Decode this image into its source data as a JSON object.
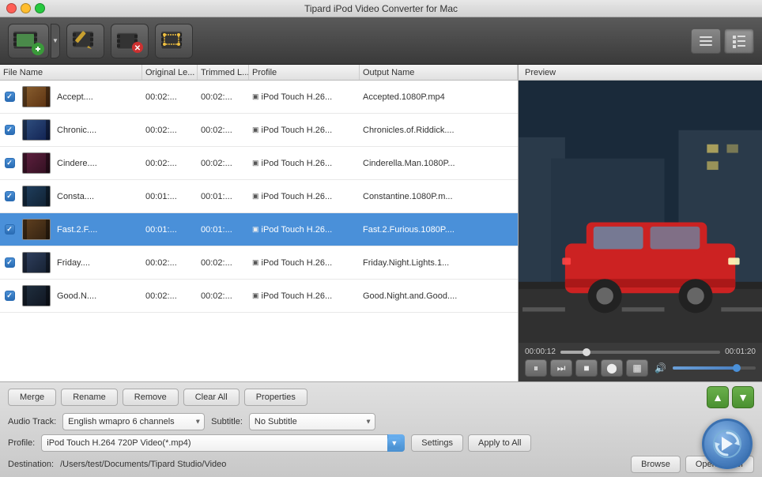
{
  "window": {
    "title": "Tipard iPod Video Converter for Mac"
  },
  "titlebar_buttons": {
    "close": "●",
    "minimize": "●",
    "maximize": "●"
  },
  "toolbar": {
    "add_video_btn": "Add Video",
    "edit_btn": "Edit",
    "trim_btn": "Trim",
    "crop_btn": "Crop",
    "view_list_btn": "List View",
    "view_detail_btn": "Detail View"
  },
  "table": {
    "headers": {
      "filename": "File Name",
      "original": "Original Le...",
      "trimmed": "Trimmed L...",
      "profile": "Profile",
      "output": "Output Name"
    },
    "rows": [
      {
        "checked": true,
        "filename": "Accept....",
        "original": "00:02:...",
        "trimmed": "00:02:...",
        "profile": "iPod Touch H.26...",
        "output": "Accepted.1080P.mp4",
        "selected": false
      },
      {
        "checked": true,
        "filename": "Chronic....",
        "original": "00:02:...",
        "trimmed": "00:02:...",
        "profile": "iPod Touch H.26...",
        "output": "Chronicles.of.Riddick....",
        "selected": false
      },
      {
        "checked": true,
        "filename": "Cinderе....",
        "original": "00:02:...",
        "trimmed": "00:02:...",
        "profile": "iPod Touch H.26...",
        "output": "Cinderella.Man.1080P...",
        "selected": false
      },
      {
        "checked": true,
        "filename": "Consta....",
        "original": "00:01:...",
        "trimmed": "00:01:...",
        "profile": "iPod Touch H.26...",
        "output": "Constantine.1080P.m...",
        "selected": false
      },
      {
        "checked": true,
        "filename": "Fast.2.F....",
        "original": "00:01:...",
        "trimmed": "00:01:...",
        "profile": "iPod Touch H.26...",
        "output": "Fast.2.Furious.1080P....",
        "selected": true
      },
      {
        "checked": true,
        "filename": "Friday....",
        "original": "00:02:...",
        "trimmed": "00:02:...",
        "profile": "iPod Touch H.26...",
        "output": "Friday.Night.Lights.1...",
        "selected": false
      },
      {
        "checked": true,
        "filename": "Good.N....",
        "original": "00:02:...",
        "trimmed": "00:02:...",
        "profile": "iPod Touch H.26...",
        "output": "Good.Night.and.Good....",
        "selected": false
      }
    ]
  },
  "preview": {
    "label": "Preview",
    "time_current": "00:00:12",
    "time_total": "00:01:20",
    "progress_pct": 15
  },
  "controls": {
    "pause": "⏸",
    "next_frame": "⏭",
    "stop": "⏹",
    "snapshot": "📷",
    "folder": "📁",
    "volume": "🔊"
  },
  "bottom_bar": {
    "buttons": {
      "merge": "Merge",
      "rename": "Rename",
      "remove": "Remove",
      "clear_all": "Clear All",
      "properties": "Properties"
    },
    "audio_track_label": "Audio Track:",
    "audio_track_value": "English wmapro 6 channels",
    "subtitle_label": "Subtitle:",
    "subtitle_value": "No Subtitle",
    "profile_label": "Profile:",
    "profile_value": "iPod Touch H.264 720P Video(*.mp4)",
    "destination_label": "Destination:",
    "destination_value": "/Users/test/Documents/Tipard Studio/Video",
    "settings_btn": "Settings",
    "apply_to_all_btn": "Apply to All",
    "browse_btn": "Browse",
    "open_folder_btn": "Open Folder"
  }
}
